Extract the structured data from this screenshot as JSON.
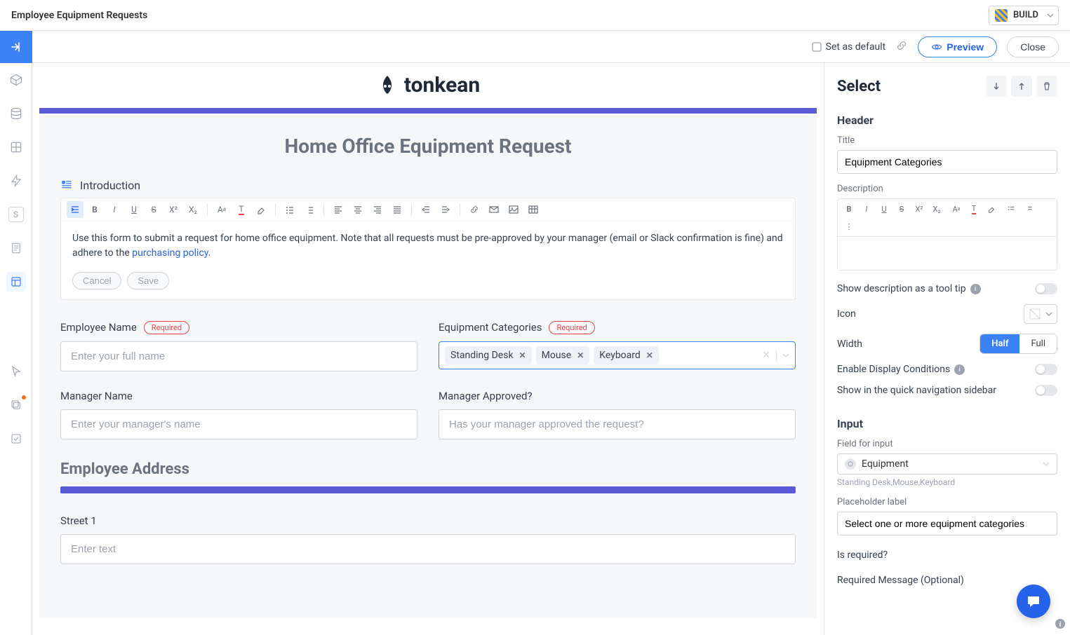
{
  "top": {
    "title": "Employee Equipment Requests",
    "mode": "BUILD"
  },
  "action_bar": {
    "set_default": "Set as default",
    "preview": "Preview",
    "close": "Close"
  },
  "form": {
    "brand": "tonkean",
    "title": "Home Office Equipment Request",
    "intro_label": "Introduction",
    "intro_text_prefix": "Use this form to submit a request for home office equipment. Note that all requests must be pre-approved by your manager (email or Slack confirmation is fine) and adhere to the ",
    "intro_link": "purchasing policy",
    "intro_text_suffix": ".",
    "cancel": "Cancel",
    "save": "Save",
    "fields": {
      "employee_name": {
        "label": "Employee Name",
        "required": "Required",
        "placeholder": "Enter your full name"
      },
      "equipment_categories": {
        "label": "Equipment Categories",
        "required": "Required",
        "chips": [
          "Standing Desk",
          "Mouse",
          "Keyboard"
        ]
      },
      "manager_name": {
        "label": "Manager Name",
        "placeholder": "Enter your manager's name"
      },
      "manager_approved": {
        "label": "Manager Approved?",
        "placeholder": "Has your manager approved the request?"
      },
      "street1": {
        "label": "Street 1",
        "placeholder": "Enter text"
      }
    },
    "address_heading": "Employee Address"
  },
  "right_panel": {
    "title": "Select",
    "header_section": "Header",
    "title_label": "Title",
    "title_value": "Equipment Categories",
    "description_label": "Description",
    "tooltip_label": "Show description as a tool tip",
    "icon_label": "Icon",
    "width_label": "Width",
    "width_half": "Half",
    "width_full": "Full",
    "display_cond": "Enable Display Conditions",
    "show_quick_nav": "Show in the quick navigation sidebar",
    "input_section": "Input",
    "field_for_input_label": "Field for input",
    "field_for_input_value": "Equipment",
    "field_hint": "Standing Desk,Mouse,Keyboard",
    "placeholder_label_label": "Placeholder label",
    "placeholder_label_value": "Select one or more equipment categories",
    "is_required_label": "Is required?",
    "required_msg_label": "Required Message (Optional)"
  }
}
